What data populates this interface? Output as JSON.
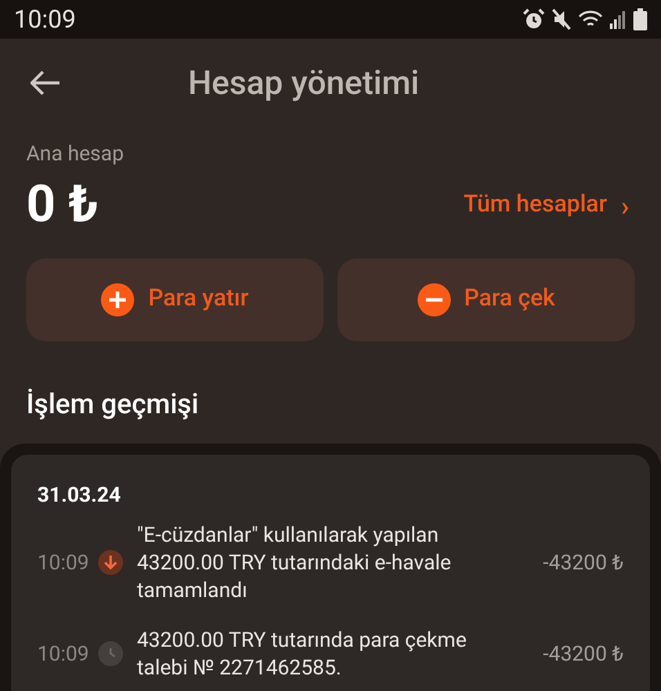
{
  "status_bar": {
    "time": "10:09"
  },
  "header": {
    "title": "Hesap yönetimi"
  },
  "account": {
    "label": "Ana hesap",
    "balance": "0 ₺",
    "all_accounts_link": "Tüm hesaplar",
    "link_chevron": "›"
  },
  "actions": [
    {
      "kind": "deposit",
      "label": "Para yatır"
    },
    {
      "kind": "withdraw",
      "label": "Para çek"
    }
  ],
  "history": {
    "title": "İşlem geçmişi",
    "date": "31.03.24",
    "transactions": [
      {
        "time": "10:09",
        "kind": "completed",
        "description": "\"E-cüzdanlar\" kullanılarak yapılan 43200.00 TRY tutarındaki e-havale tamamlandı",
        "amount": "-43200 ₺"
      },
      {
        "time": "10:09",
        "kind": "pending",
        "description": "43200.00 TRY tutarında para çekme talebi № 2271462585.",
        "amount": "-43200 ₺"
      }
    ]
  }
}
